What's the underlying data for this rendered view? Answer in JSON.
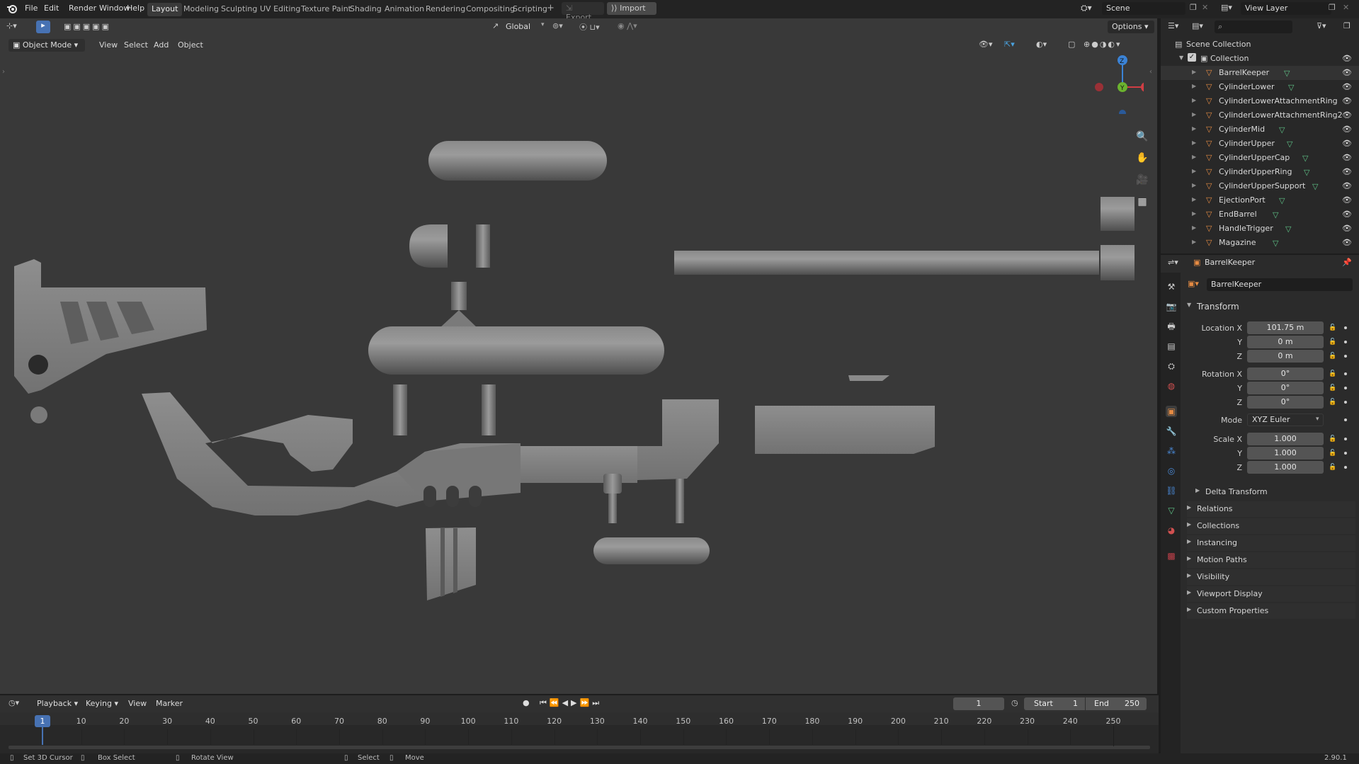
{
  "topbar": {
    "menus": [
      "File",
      "Edit",
      "Render",
      "Window",
      "Help"
    ],
    "workspaces": [
      "Layout",
      "Modeling",
      "Sculpting",
      "UV Editing",
      "Texture Paint",
      "Shading",
      "Animation",
      "Rendering",
      "Compositing",
      "Scripting"
    ],
    "add_tab": "+",
    "export_label": "Export",
    "import_label": "Import",
    "scene_name": "Scene",
    "view_layer": "View Layer"
  },
  "tool_header": {
    "orientation": "Global",
    "options_label": "Options"
  },
  "viewport_header": {
    "mode": "Object Mode",
    "menus": [
      "View",
      "Select",
      "Add",
      "Object"
    ]
  },
  "gizmo": {
    "z": "Z",
    "y": "Y",
    "x": "X"
  },
  "outliner": {
    "search_placeholder": "",
    "scene_collection": "Scene Collection",
    "collection": "Collection",
    "objects": [
      "BarrelKeeper",
      "CylinderLower",
      "CylinderLowerAttachmentRing",
      "CylinderLowerAttachmentRing2",
      "CylinderMid",
      "CylinderUpper",
      "CylinderUpperCap",
      "CylinderUpperRing",
      "CylinderUpperSupport",
      "EjectionPort",
      "EndBarrel",
      "HandleTrigger",
      "Magazine"
    ]
  },
  "properties": {
    "header_object": "BarrelKeeper",
    "object_name": "BarrelKeeper",
    "transform_title": "Transform",
    "location_label": "Location X",
    "location": [
      "101.75 m",
      "0 m",
      "0 m"
    ],
    "rotation_label": "Rotation X",
    "rotation": [
      "0°",
      "0°",
      "0°"
    ],
    "mode_label": "Mode",
    "mode_value": "XYZ Euler",
    "scale_label": "Scale X",
    "scale": [
      "1.000",
      "1.000",
      "1.000"
    ],
    "axis_y": "Y",
    "axis_z": "Z",
    "delta_transform": "Delta Transform",
    "panels": [
      "Relations",
      "Collections",
      "Instancing",
      "Motion Paths",
      "Visibility",
      "Viewport Display",
      "Custom Properties"
    ]
  },
  "timeline": {
    "menus": [
      "Playback",
      "Keying",
      "View",
      "Marker"
    ],
    "current_frame": "1",
    "start_label": "Start",
    "start": "1",
    "end_label": "End",
    "end": "250",
    "ticks": [
      "10",
      "20",
      "30",
      "40",
      "50",
      "60",
      "70",
      "80",
      "90",
      "100",
      "110",
      "120",
      "130",
      "140",
      "150",
      "160",
      "170",
      "180",
      "190",
      "200",
      "210",
      "220",
      "230",
      "240",
      "250"
    ],
    "playhead": "1"
  },
  "statusbar": {
    "items": [
      "Set 3D Cursor",
      "Box Select",
      "Rotate View",
      "Select",
      "Move"
    ],
    "version": "2.90.1"
  }
}
